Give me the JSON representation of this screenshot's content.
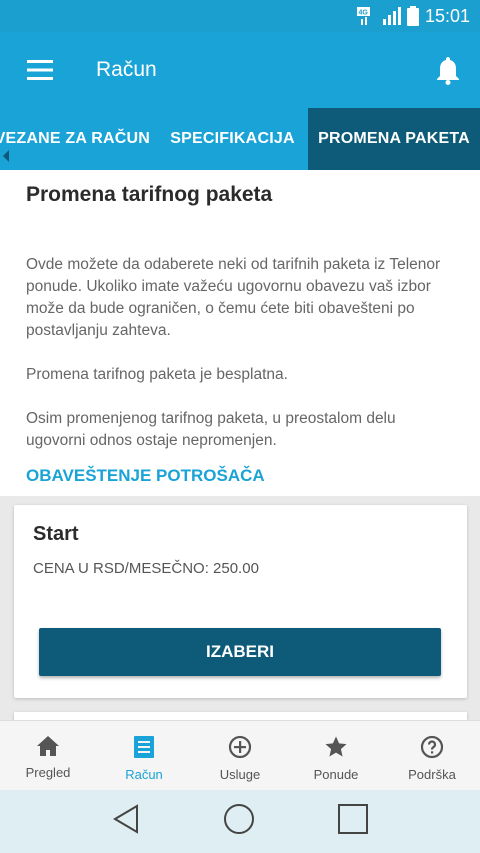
{
  "status_bar": {
    "network": "4G",
    "time": "15:01"
  },
  "app_bar": {
    "title": "Račun"
  },
  "tabs": [
    {
      "label": "E VEZANE ZA RAČUN",
      "active": false
    },
    {
      "label": "SPECIFIKACIJA",
      "active": false
    },
    {
      "label": "PROMENA PAKETA",
      "active": true
    }
  ],
  "content": {
    "heading": "Promena tarifnog paketa",
    "paragraphs": [
      "Ovde možete da odaberete neki od tarifnih paketa iz Telenor ponude. Ukoliko imate važeću ugovornu obavezu vaš izbor može da bude ograničen, o čemu ćete biti obavešteni po postavljanju zahteva.",
      "Promena tarifnog paketa je besplatna.",
      "Osim promenjenog tarifnog paketa, u preostalom delu ugovorni odnos ostaje nepromenjen."
    ],
    "notice_link": "OBAVEŠTENJE POTROŠAČA"
  },
  "package_card": {
    "name": "Start",
    "price": "CENA U RSD/MESEČNO: 250.00",
    "button": "IZABERI"
  },
  "bottom_nav": [
    {
      "label": "Pregled",
      "icon": "home-icon",
      "active": false
    },
    {
      "label": "Račun",
      "icon": "receipt-icon",
      "active": true
    },
    {
      "label": "Usluge",
      "icon": "add-circle-icon",
      "active": false
    },
    {
      "label": "Ponude",
      "icon": "star-icon",
      "active": false
    },
    {
      "label": "Podrška",
      "icon": "help-icon",
      "active": false
    }
  ],
  "colors": {
    "primary": "#1aa3d6",
    "dark_accent": "#0d5b78",
    "status_bar": "#1a9fcf"
  }
}
